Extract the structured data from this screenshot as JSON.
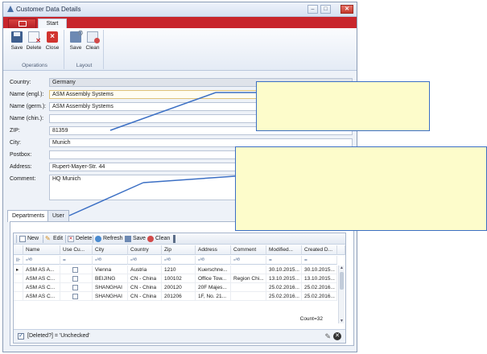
{
  "window": {
    "title": "Customer Data Details",
    "controls": {
      "minimize": "–",
      "maximize": "□",
      "close": "✕"
    }
  },
  "ribbon": {
    "tab": "Start",
    "groups": [
      {
        "caption": "Operations",
        "buttons": [
          "Save",
          "Delete",
          "Close"
        ]
      },
      {
        "caption": "Layout",
        "buttons": [
          "Save",
          "Clean"
        ]
      }
    ]
  },
  "form": {
    "fields": [
      {
        "label": "Country:",
        "value": "Germany"
      },
      {
        "label": "Name (engl.):",
        "value": "ASM Assembly Systems"
      },
      {
        "label": "Name (germ.):",
        "value": "ASM Assembly Systems"
      },
      {
        "label": "Name (chin.):",
        "value": ""
      },
      {
        "label": "ZIP:",
        "value": "81359"
      },
      {
        "label": "City:",
        "value": "Munich"
      },
      {
        "label": "Postbox:",
        "value": ""
      },
      {
        "label": "Address:",
        "value": "Rupert-Mayer-Str. 44"
      },
      {
        "label": "Comment:",
        "value": "HQ Munich"
      }
    ]
  },
  "tabs": [
    "Departments",
    "User"
  ],
  "grid": {
    "toolbar": [
      "New",
      "Edit",
      "Delete",
      "Refresh",
      "Save",
      "Clean"
    ],
    "columns": [
      "Name",
      "Use Cu...",
      "City",
      "Country",
      "Zip",
      "Address",
      "Comment",
      "Modified...",
      "Created D..."
    ],
    "filter_row": [
      "▫ᴬᴮ",
      "=",
      "▫ᴬᴮ",
      "▫ᴬᴮ",
      "▫ᴬᴮ",
      "▫ᴬᴮ",
      "▫ᴬᴮ",
      "=",
      "="
    ],
    "rows": [
      [
        "ASM AS A...",
        "",
        "Vienna",
        "Austria",
        "1210",
        "Kuerschne...",
        "",
        "30.10.2015...",
        "30.10.2015..."
      ],
      [
        "ASM AS C...",
        "",
        "BEIJING",
        "CN - China",
        "100102",
        "Office Tow...",
        "Region Chi...",
        "13.10.2015...",
        "13.10.2015..."
      ],
      [
        "ASM AS C...",
        "",
        "SHANGHAI",
        "CN - China",
        "200120",
        "20F Majes...",
        "",
        "25.02.2016...",
        "25.02.2016..."
      ],
      [
        "ASM AS C...",
        "",
        "SHANGHAI",
        "CN - China",
        "201206",
        "1F, No. 21...",
        "",
        "25.02.2016...",
        "25.02.2016..."
      ]
    ],
    "count": "Count=32",
    "filter_text": "[Deleted?] = 'Unchecked'"
  },
  "colors": {
    "ribbon_red": "#c8262c",
    "callout_fill": "#fdfccb",
    "callout_border": "#3b6fc4"
  }
}
